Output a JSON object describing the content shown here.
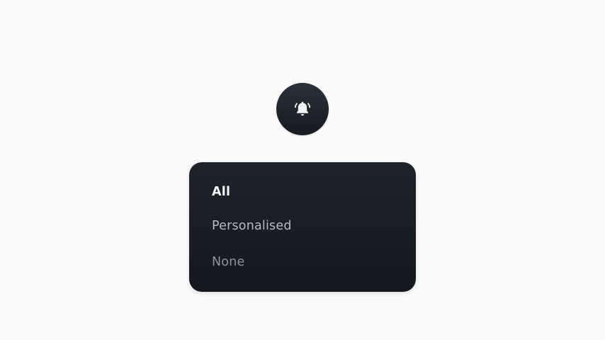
{
  "notification_button": {
    "icon": "bell-ringing-icon"
  },
  "menu": {
    "items": [
      {
        "label": "All",
        "selected": true
      },
      {
        "label": "Personalised",
        "selected": false
      },
      {
        "label": "None",
        "selected": false
      }
    ]
  },
  "colors": {
    "background": "#fafafa",
    "panel_top": "#1e232b",
    "panel_bottom": "#14181e",
    "selected_text": "#f4f5f7",
    "muted_text": "#b6bac2",
    "dim_text": "#8d929b"
  }
}
